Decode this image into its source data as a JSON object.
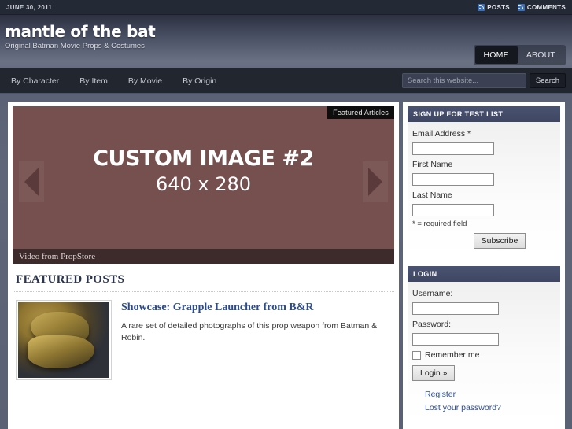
{
  "topbar": {
    "date": "JUNE 30, 2011",
    "feeds": [
      {
        "label": "POSTS",
        "icon": "rss-icon"
      },
      {
        "label": "COMMENTS",
        "icon": "rss-icon"
      }
    ]
  },
  "header": {
    "site_title": "mantle of the bat",
    "tagline": "Original Batman Movie Props & Costumes",
    "nav": [
      {
        "label": "HOME",
        "active": true
      },
      {
        "label": "ABOUT",
        "active": false
      }
    ]
  },
  "subnav": {
    "links": [
      "By Character",
      "By Item",
      "By Movie",
      "By Origin"
    ],
    "search": {
      "placeholder": "Search this website...",
      "value": "",
      "button_label": "Search"
    }
  },
  "slider": {
    "tab_label": "Featured Articles",
    "title": "CUSTOM IMAGE #2",
    "subtitle": "640 x 280",
    "caption": "Video from PropStore",
    "prev_icon": "arrow-left-icon",
    "next_icon": "arrow-right-icon",
    "bg_color": "#75504f"
  },
  "featured": {
    "heading": "FEATURED POSTS",
    "posts": [
      {
        "title": "Showcase: Grapple Launcher from B&R",
        "excerpt": "A rare set of detailed photographs of this prop weapon from Batman & Robin.",
        "thumb_alt": "grapple-launcher-photo"
      }
    ]
  },
  "sidebar": {
    "signup": {
      "heading": "SIGN UP FOR TEST LIST",
      "fields": [
        {
          "label": "Email Address *",
          "value": ""
        },
        {
          "label": "First Name",
          "value": ""
        },
        {
          "label": "Last Name",
          "value": ""
        }
      ],
      "note": "* = required field",
      "button_label": "Subscribe"
    },
    "login": {
      "heading": "LOGIN",
      "username_label": "Username:",
      "username_value": "",
      "password_label": "Password:",
      "password_value": "",
      "remember_label": "Remember me",
      "button_label": "Login »",
      "links": [
        "Register",
        "Lost your password?"
      ]
    }
  },
  "colors": {
    "page_bg": "#5d6478",
    "header_dark": "#2c3040",
    "nav_bar": "#22262f",
    "widget_head": "#434b69",
    "link": "#2b4b8c",
    "slider": "#75504f",
    "rss": "#3d6fb5"
  }
}
